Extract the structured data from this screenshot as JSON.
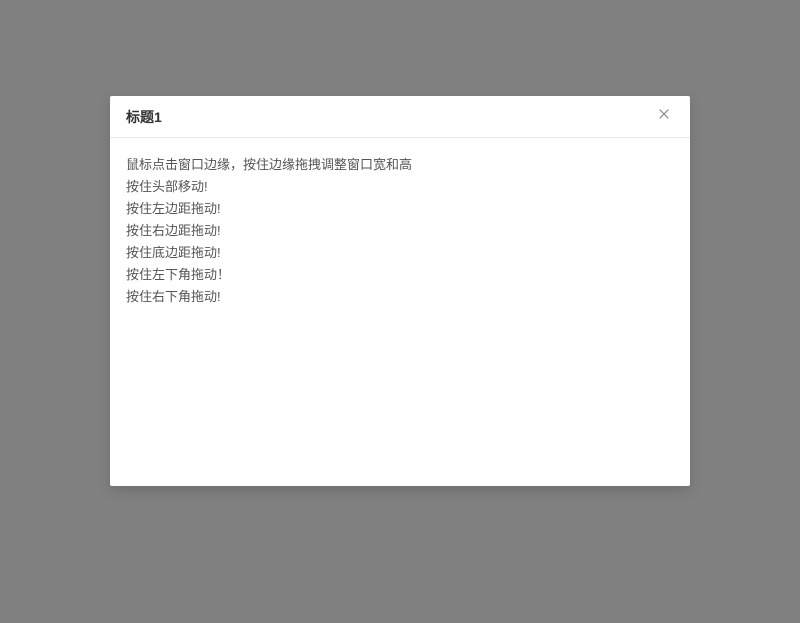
{
  "modal": {
    "title": "标题1",
    "body_lines": [
      "鼠标点击窗口边缘，按住边缘拖拽调整窗口宽和高",
      "按住头部移动!",
      "按住左边距拖动!",
      "按住右边距拖动!",
      "按住底边距拖动!",
      "按住左下角拖动！",
      "按住右下角拖动!"
    ]
  }
}
